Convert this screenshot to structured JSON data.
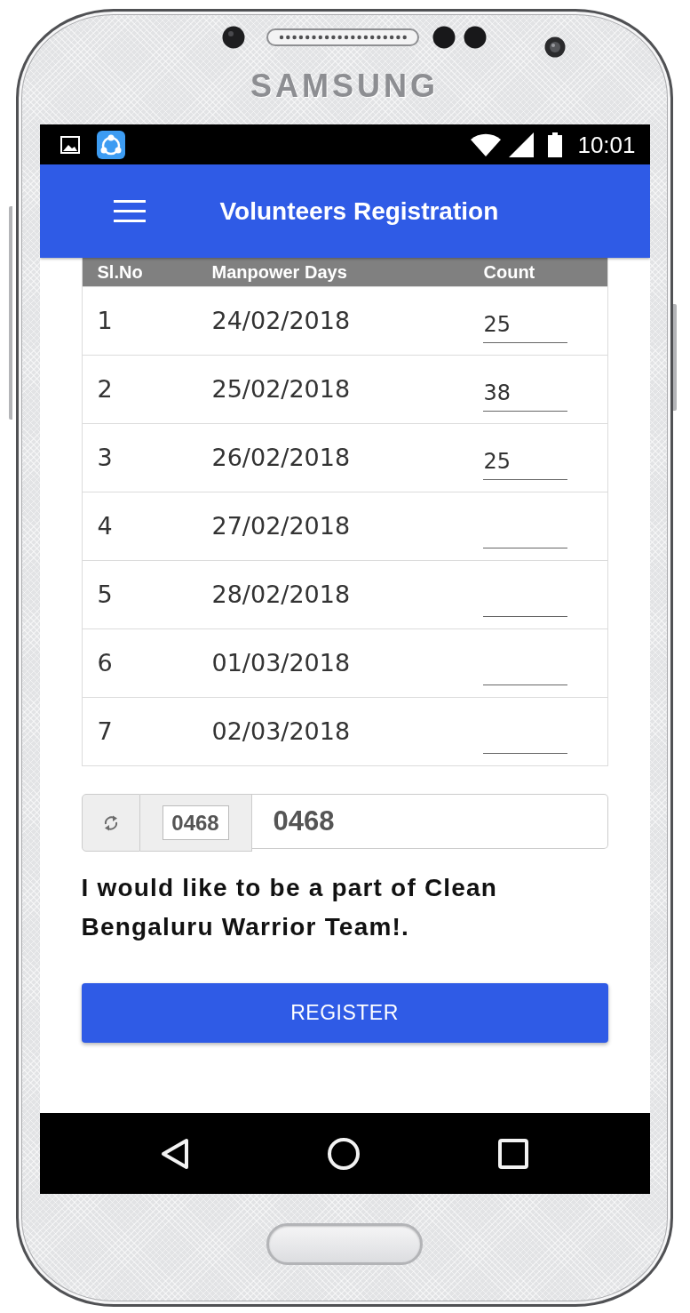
{
  "device": {
    "brand": "SAMSUNG"
  },
  "status_bar": {
    "time": "10:01"
  },
  "app_bar": {
    "title": "Volunteers Registration"
  },
  "table": {
    "columns": [
      "Sl.No",
      "Manpower Days",
      "Count"
    ],
    "rows": [
      {
        "no": "1",
        "date": "24/02/2018",
        "count": "25"
      },
      {
        "no": "2",
        "date": "25/02/2018",
        "count": "38"
      },
      {
        "no": "3",
        "date": "26/02/2018",
        "count": "25"
      },
      {
        "no": "4",
        "date": "27/02/2018"
      },
      {
        "no": "5",
        "date": "28/02/2018"
      },
      {
        "no": "6",
        "date": "01/03/2018"
      },
      {
        "no": "7",
        "date": "02/03/2018"
      }
    ]
  },
  "captcha": {
    "code": "0468",
    "value": "0468"
  },
  "consent_text": "I would like to be a part of Clean Bengaluru Warrior Team!.",
  "register_button": "REGISTER"
}
